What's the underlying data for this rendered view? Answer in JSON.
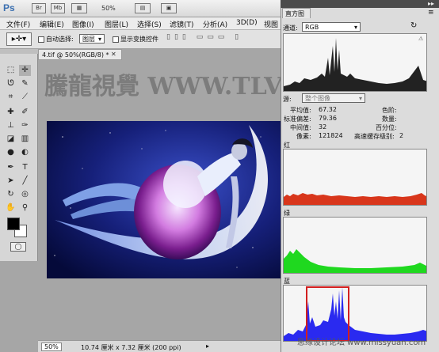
{
  "app": {
    "logo": "Ps",
    "zoom": "50%",
    "icon_br": "Br",
    "icon_mb": "Mb"
  },
  "menu": [
    "文件(F)",
    "编辑(E)",
    "图像(I)",
    "图层(L)",
    "选择(S)",
    "滤镜(T)",
    "分析(A)",
    "3D(D)",
    "视图"
  ],
  "options": {
    "auto_select_label": "自动选择:",
    "auto_select_value": "图层",
    "show_transform_label": "显示变换控件"
  },
  "document": {
    "tab_title": "4.tif @ 50%(RGB/8) *",
    "status_zoom": "50%",
    "status_info": "10.74 厘米 x 7.32 厘米 (200 ppi)"
  },
  "watermark": {
    "text": "騰龍視覺 WWW.TLVI.NET",
    "corner": "思缘设计论坛 www.missyuan.com"
  },
  "histogram": {
    "tab": "直方图",
    "channel_label": "通道:",
    "channel_value": "RGB",
    "source_label": "源:",
    "source_value": "整个图像",
    "stats": {
      "mean_label": "平均值:",
      "mean": "67.32",
      "std_label": "标准偏差:",
      "std": "79.36",
      "median_label": "中间值:",
      "median": "32",
      "pixels_label": "像素:",
      "pixels": "121824",
      "level_label": "色阶:",
      "level": "",
      "count_label": "数量:",
      "count": "",
      "percentile_label": "百分位:",
      "percentile": "",
      "cache_label": "高速缓存级别:",
      "cache": "2"
    },
    "channels": [
      {
        "name": "红",
        "color": "#d8361b"
      },
      {
        "name": "绿",
        "color": "#1fd81f"
      },
      {
        "name": "蓝",
        "color": "#2a2af0"
      }
    ],
    "highlight_color": "#d21f1f"
  }
}
